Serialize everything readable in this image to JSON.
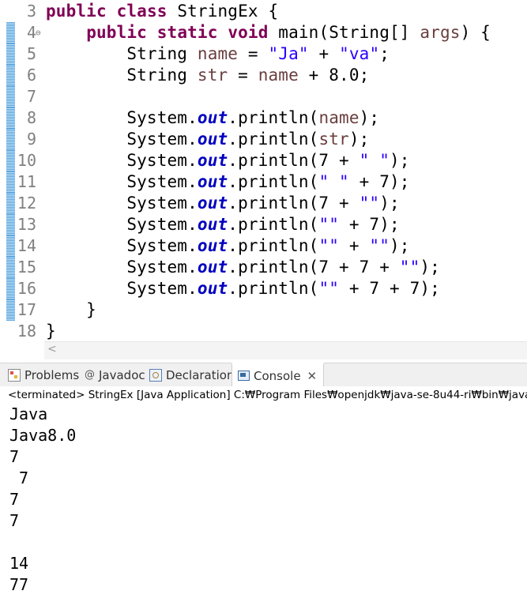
{
  "editor": {
    "lines": [
      {
        "num": "3",
        "marker": false,
        "fold": ""
      },
      {
        "num": "4",
        "marker": true,
        "fold": "⊖"
      },
      {
        "num": "5",
        "marker": true,
        "fold": ""
      },
      {
        "num": "6",
        "marker": true,
        "fold": ""
      },
      {
        "num": "7",
        "marker": true,
        "fold": ""
      },
      {
        "num": "8",
        "marker": true,
        "fold": ""
      },
      {
        "num": "9",
        "marker": true,
        "fold": ""
      },
      {
        "num": "10",
        "marker": true,
        "fold": ""
      },
      {
        "num": "11",
        "marker": true,
        "fold": ""
      },
      {
        "num": "12",
        "marker": true,
        "fold": ""
      },
      {
        "num": "13",
        "marker": true,
        "fold": ""
      },
      {
        "num": "14",
        "marker": true,
        "fold": ""
      },
      {
        "num": "15",
        "marker": true,
        "fold": ""
      },
      {
        "num": "16",
        "marker": true,
        "fold": ""
      },
      {
        "num": "17",
        "marker": true,
        "fold": ""
      },
      {
        "num": "18",
        "marker": false,
        "fold": ""
      }
    ],
    "code": [
      [
        {
          "t": "kw",
          "v": "public"
        },
        {
          "t": "p",
          "v": " "
        },
        {
          "t": "kw",
          "v": "class"
        },
        {
          "t": "p",
          "v": " StringEx {"
        }
      ],
      [
        {
          "t": "p",
          "v": "    "
        },
        {
          "t": "kw",
          "v": "public"
        },
        {
          "t": "p",
          "v": " "
        },
        {
          "t": "kw",
          "v": "static"
        },
        {
          "t": "p",
          "v": " "
        },
        {
          "t": "kw",
          "v": "void"
        },
        {
          "t": "p",
          "v": " main(String[] "
        },
        {
          "t": "var",
          "v": "args"
        },
        {
          "t": "p",
          "v": ") {"
        }
      ],
      [
        {
          "t": "p",
          "v": "        String "
        },
        {
          "t": "var",
          "v": "name"
        },
        {
          "t": "p",
          "v": " = "
        },
        {
          "t": "str",
          "v": "\"Ja\""
        },
        {
          "t": "p",
          "v": " + "
        },
        {
          "t": "str",
          "v": "\"va\""
        },
        {
          "t": "p",
          "v": ";"
        }
      ],
      [
        {
          "t": "p",
          "v": "        String "
        },
        {
          "t": "var",
          "v": "str"
        },
        {
          "t": "p",
          "v": " = "
        },
        {
          "t": "var",
          "v": "name"
        },
        {
          "t": "p",
          "v": " + 8.0;"
        }
      ],
      [],
      [
        {
          "t": "p",
          "v": "        System."
        },
        {
          "t": "fld",
          "v": "out"
        },
        {
          "t": "p",
          "v": ".println("
        },
        {
          "t": "var",
          "v": "name"
        },
        {
          "t": "p",
          "v": ");"
        }
      ],
      [
        {
          "t": "p",
          "v": "        System."
        },
        {
          "t": "fld",
          "v": "out"
        },
        {
          "t": "p",
          "v": ".println("
        },
        {
          "t": "var",
          "v": "str"
        },
        {
          "t": "p",
          "v": ");"
        }
      ],
      [
        {
          "t": "p",
          "v": "        System."
        },
        {
          "t": "fld",
          "v": "out"
        },
        {
          "t": "p",
          "v": ".println(7 + "
        },
        {
          "t": "str",
          "v": "\" \""
        },
        {
          "t": "p",
          "v": ");"
        }
      ],
      [
        {
          "t": "p",
          "v": "        System."
        },
        {
          "t": "fld",
          "v": "out"
        },
        {
          "t": "p",
          "v": ".println("
        },
        {
          "t": "str",
          "v": "\" \""
        },
        {
          "t": "p",
          "v": " + 7);"
        }
      ],
      [
        {
          "t": "p",
          "v": "        System."
        },
        {
          "t": "fld",
          "v": "out"
        },
        {
          "t": "p",
          "v": ".println(7 + "
        },
        {
          "t": "str",
          "v": "\"\""
        },
        {
          "t": "p",
          "v": ");"
        }
      ],
      [
        {
          "t": "p",
          "v": "        System."
        },
        {
          "t": "fld",
          "v": "out"
        },
        {
          "t": "p",
          "v": ".println("
        },
        {
          "t": "str",
          "v": "\"\""
        },
        {
          "t": "p",
          "v": " + 7);"
        }
      ],
      [
        {
          "t": "p",
          "v": "        System."
        },
        {
          "t": "fld",
          "v": "out"
        },
        {
          "t": "p",
          "v": ".println("
        },
        {
          "t": "str",
          "v": "\"\""
        },
        {
          "t": "p",
          "v": " + "
        },
        {
          "t": "str",
          "v": "\"\""
        },
        {
          "t": "p",
          "v": ");"
        }
      ],
      [
        {
          "t": "p",
          "v": "        System."
        },
        {
          "t": "fld",
          "v": "out"
        },
        {
          "t": "p",
          "v": ".println(7 + 7 + "
        },
        {
          "t": "str",
          "v": "\"\""
        },
        {
          "t": "p",
          "v": ");"
        }
      ],
      [
        {
          "t": "p",
          "v": "        System."
        },
        {
          "t": "fld",
          "v": "out"
        },
        {
          "t": "p",
          "v": ".println("
        },
        {
          "t": "str",
          "v": "\"\""
        },
        {
          "t": "p",
          "v": " + 7 + 7);"
        }
      ],
      [
        {
          "t": "p",
          "v": "    }"
        }
      ],
      [
        {
          "t": "p",
          "v": "}"
        }
      ]
    ]
  },
  "scroll_arrow": "<",
  "tabs": [
    {
      "label": "Problems",
      "icon": "problems-icon",
      "active": false
    },
    {
      "label": "Javadoc",
      "icon": "javadoc-icon",
      "active": false
    },
    {
      "label": "Declaration",
      "icon": "declaration-icon",
      "active": false
    },
    {
      "label": "Console",
      "icon": "console-icon",
      "active": true
    }
  ],
  "close_glyph": "✕",
  "javadoc_glyph": "@",
  "console": {
    "status": "<terminated> StringEx [Java Application] C:₩Program Files₩openjdk₩java-se-8u44-ri₩bin₩javaw.exe",
    "output": [
      "Java",
      "Java8.0",
      "7",
      " 7",
      "7",
      "7",
      "",
      "14",
      "77"
    ]
  },
  "colors": {
    "keyword": "#7f0055",
    "string": "#2a00ff",
    "local_variable": "#6a3e3e",
    "static_field": "#0000c0",
    "line_number": "#808080"
  }
}
